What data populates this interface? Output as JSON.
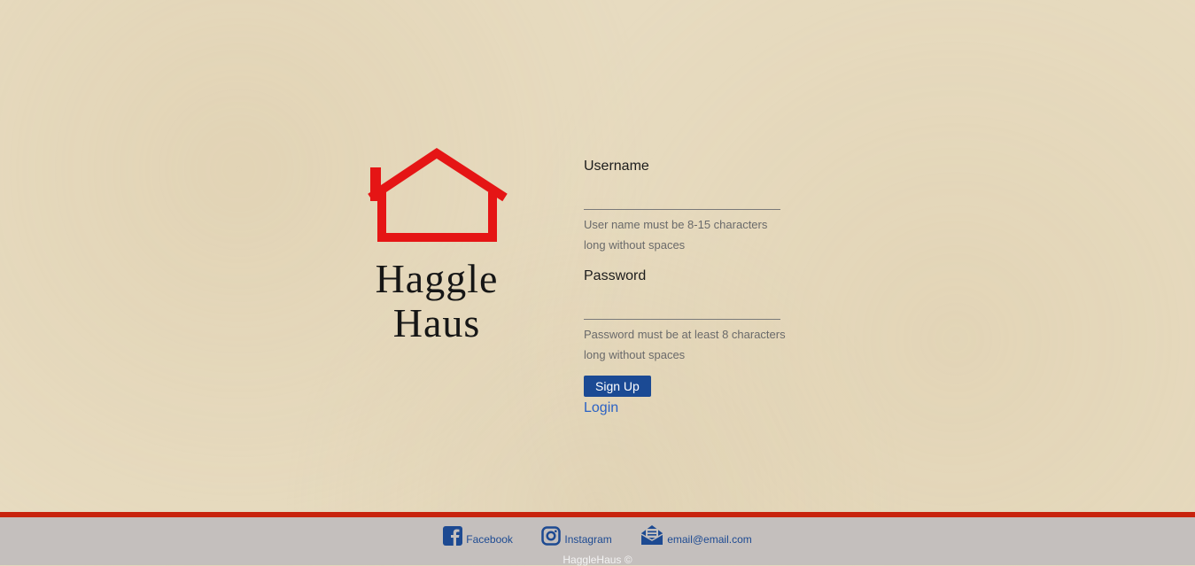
{
  "brand": {
    "line1": "Haggle",
    "line2": "Haus",
    "logo_color": "#e51515"
  },
  "form": {
    "username_label": "Username",
    "username_value": "",
    "username_hint": "User name must be 8-15 characters long without spaces",
    "password_label": "Password",
    "password_value": "",
    "password_hint": "Password must be at least 8 characters long without spaces",
    "signup_label": "Sign Up",
    "login_label": "Login"
  },
  "footer": {
    "facebook_label": "Facebook",
    "instagram_label": "Instagram",
    "email_label": "email@email.com",
    "copyright": "HaggleHaus ©",
    "icons": [
      "facebook-icon",
      "instagram-icon",
      "email-icon"
    ]
  },
  "colors": {
    "background": "#e7dbc0",
    "accent_red": "#c8230d",
    "button_blue": "#1b4a94",
    "link_blue": "#2b62c4",
    "footer_gray": "#c4bfbd"
  }
}
